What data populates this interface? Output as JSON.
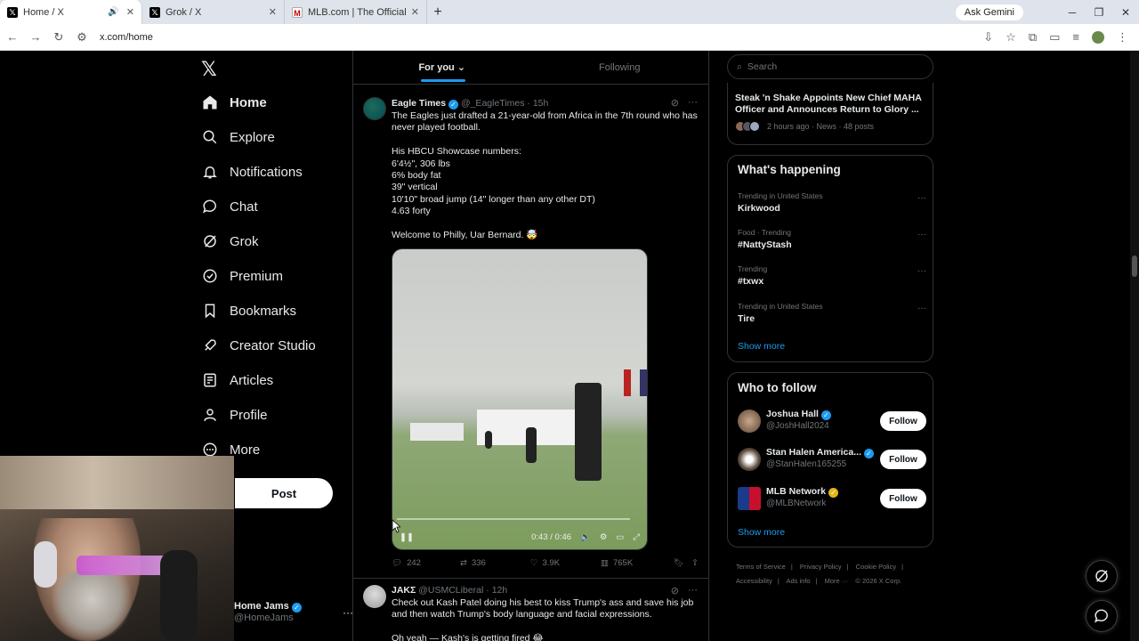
{
  "browser": {
    "tabs": [
      {
        "title": "Home / X",
        "active": true
      },
      {
        "title": "Grok / X",
        "active": false
      },
      {
        "title": "MLB.com | The Official Site of M",
        "active": false
      }
    ],
    "ask_gemini": "Ask Gemini",
    "url": "x.com/home"
  },
  "nav": {
    "items": [
      {
        "label": "Home",
        "icon": "home-icon"
      },
      {
        "label": "Explore",
        "icon": "search-icon"
      },
      {
        "label": "Notifications",
        "icon": "bell-icon"
      },
      {
        "label": "Chat",
        "icon": "chat-icon"
      },
      {
        "label": "Grok",
        "icon": "grok-icon"
      },
      {
        "label": "Premium",
        "icon": "verified-icon"
      },
      {
        "label": "Bookmarks",
        "icon": "bookmark-icon"
      },
      {
        "label": "Creator Studio",
        "icon": "rocket-icon"
      },
      {
        "label": "Articles",
        "icon": "article-icon"
      },
      {
        "label": "Profile",
        "icon": "person-icon"
      },
      {
        "label": "More",
        "icon": "more-icon"
      }
    ],
    "post_label": "Post",
    "account": {
      "name": "Home Jams",
      "handle": "@HomeJams"
    }
  },
  "feed": {
    "tabs": [
      {
        "label": "For you",
        "active": true
      },
      {
        "label": "Following",
        "active": false
      }
    ],
    "tweets": [
      {
        "name": "Eagle Times",
        "handle": "@_EagleTimes",
        "time": "15h",
        "text": "The Eagles just drafted a 21-year-old from Africa in the 7th round who has never played football.\n\nHis HBCU Showcase numbers:\n6'4½\", 306 lbs\n6% body fat\n39\" vertical\n10'10\" broad jump (14\" longer than any other DT)\n4.63 forty\n\nWelcome to Philly, Uar Bernard. 🤯",
        "video_time": "0:43 / 0:46",
        "replies": "242",
        "reposts": "336",
        "likes": "3.9K",
        "views": "765K"
      },
      {
        "name": "JAKΣ",
        "handle": "@USMCLiberal",
        "time": "12h",
        "text": "Check out Kash Patel doing his best to kiss Trump's ass and save his job and then watch Trump's body language and facial expressions.\n\nOh yeah — Kash's is getting fired 😂"
      }
    ]
  },
  "sidebar": {
    "search_placeholder": "Search",
    "news": {
      "title": "Steak 'n Shake Appoints New Chief MAHA Officer and Announces Return to Glory ...",
      "meta": "2 hours ago · News · 48 posts"
    },
    "happening": {
      "title": "What's happening",
      "trends": [
        {
          "context": "Trending in United States",
          "name": "Kirkwood"
        },
        {
          "context": "Food · Trending",
          "name": "#NattyStash"
        },
        {
          "context": "Trending",
          "name": "#txwx"
        },
        {
          "context": "Trending in United States",
          "name": "Tire"
        }
      ],
      "show_more": "Show more"
    },
    "who_to_follow": {
      "title": "Who to follow",
      "accounts": [
        {
          "name": "Joshua Hall",
          "handle": "@JoshHall2024",
          "badge": "blue"
        },
        {
          "name": "Stan Halen America...",
          "handle": "@StanHalen165255",
          "badge": "blue"
        },
        {
          "name": "MLB Network",
          "handle": "@MLBNetwork",
          "badge": "gold"
        }
      ],
      "follow_label": "Follow",
      "show_more": "Show more"
    },
    "footer": [
      "Terms of Service",
      "|",
      "Privacy Policy",
      "|",
      "Cookie Policy",
      "|",
      "Accessibility",
      "|",
      "Ads info",
      "|",
      "More ···",
      "© 2026 X Corp."
    ]
  },
  "colors": {
    "accent": "#1d9bf0",
    "gold_badge": "#e2b719",
    "background": "#000000"
  }
}
